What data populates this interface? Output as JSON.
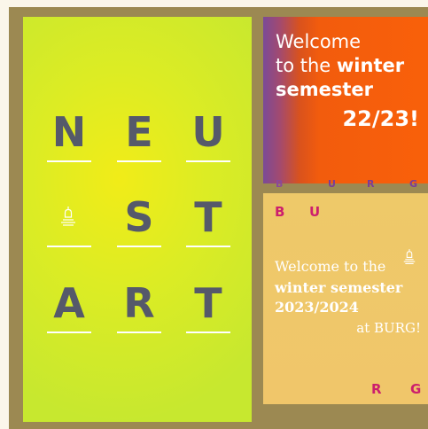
{
  "left_poster": {
    "rows": [
      [
        "N",
        "E",
        "U"
      ],
      [
        "",
        "S",
        "T"
      ],
      [
        "A",
        "R",
        "T"
      ]
    ],
    "icon": "tower-icon"
  },
  "top_right_poster": {
    "line1": "Welcome",
    "line2_prefix": "to the ",
    "line2_bold": "winter",
    "line3": "semester",
    "year": "22/23!",
    "burg_letters": [
      "B",
      "U",
      "R",
      "G"
    ]
  },
  "bottom_right_poster": {
    "letters_top": [
      "B",
      "U"
    ],
    "line1": "Welcome to the",
    "line2": "winter semester",
    "line3": "2023/2024",
    "line4": "at BURG!",
    "letters_bottom": [
      "R",
      "G"
    ],
    "icon": "tower-icon"
  },
  "colors": {
    "frame": "#9c8952",
    "lime": "#d5ea29",
    "orange": "#f9600a",
    "sand": "#efc76a",
    "magenta": "#cc1f6d",
    "slate": "#55596a"
  }
}
